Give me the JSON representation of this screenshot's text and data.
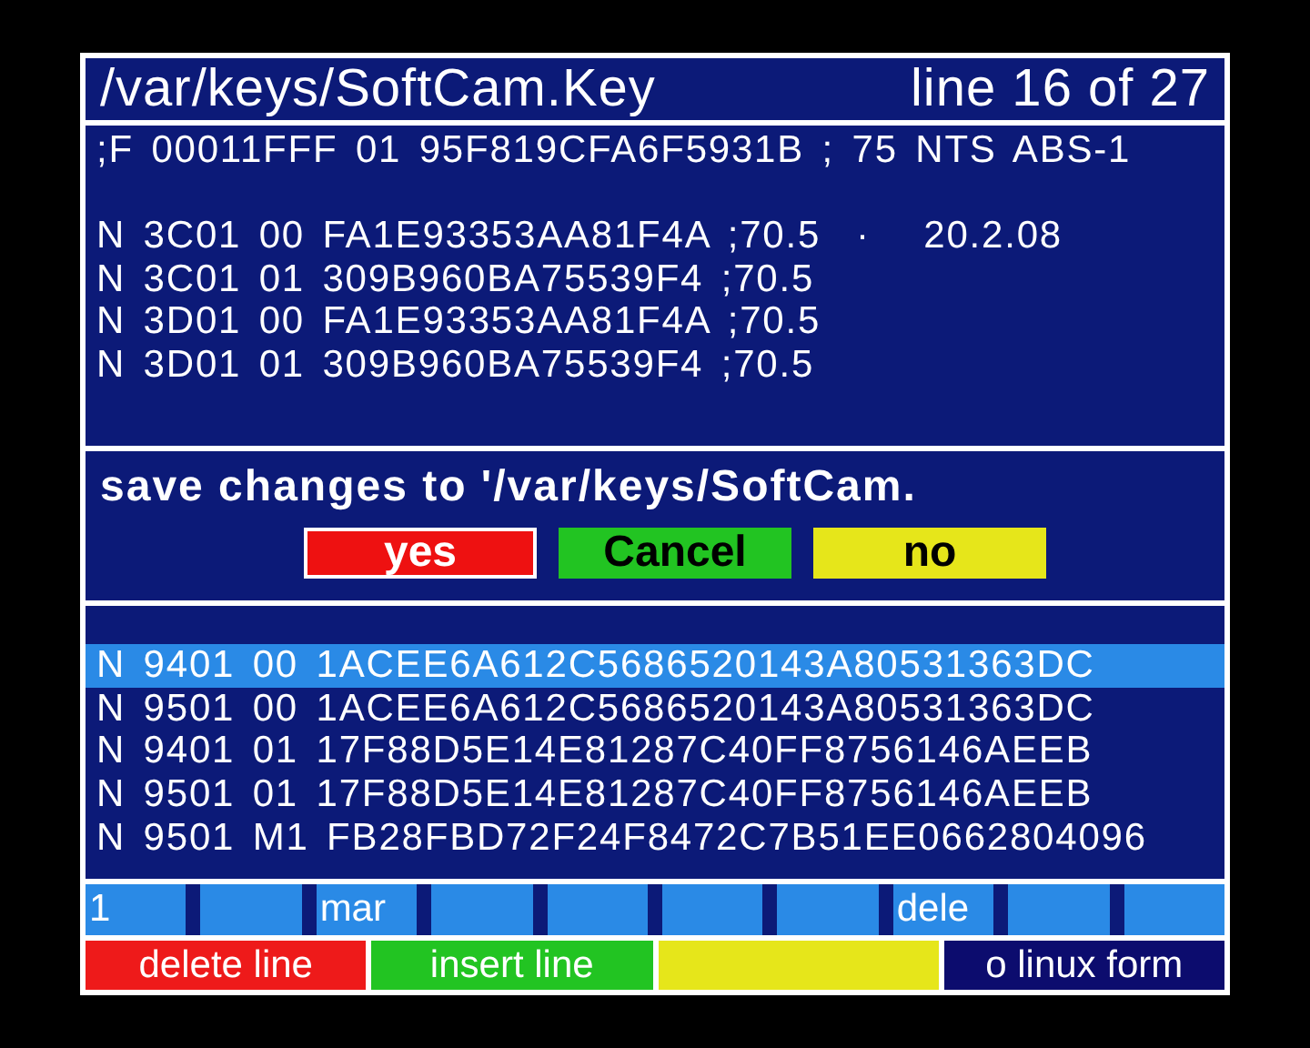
{
  "header": {
    "path": "/var/keys/SoftCam.Key",
    "position": "line 16 of 27"
  },
  "lines": [
    {
      "kind": "text",
      "text": ";F 00011FFF 01 95F819CFA6F5931B ; 75 NTS ABS-1",
      "selected": false
    },
    {
      "kind": "gap"
    },
    {
      "kind": "text",
      "text": "N 3C01 00 FA1E93353AA81F4A ;70.5  ·   20.2.08",
      "selected": false
    },
    {
      "kind": "text",
      "text": "N 3C01 01 309B960BA75539F4 ;70.5",
      "selected": false
    },
    {
      "kind": "text",
      "text": "N 3D01 00 FA1E93353AA81F4A ;70.5",
      "selected": false
    },
    {
      "kind": "text",
      "text": "N 3D01 01 309B960BA75539F4 ;70.5",
      "selected": false
    },
    {
      "kind": "gap"
    },
    {
      "kind": "gap"
    },
    {
      "kind": "gap"
    },
    {
      "kind": "gap"
    },
    {
      "kind": "gap"
    },
    {
      "kind": "gap"
    },
    {
      "kind": "text",
      "text": "N 9401 00 1ACEE6A612C5686520143A80531363DC",
      "selected": true
    },
    {
      "kind": "text",
      "text": "N 9501 00 1ACEE6A612C5686520143A80531363DC",
      "selected": false
    },
    {
      "kind": "text",
      "text": "N 9401 01 17F88D5E14E81287C40FF8756146AEEB",
      "selected": false
    },
    {
      "kind": "text",
      "text": "N 9501 01 17F88D5E14E81287C40FF8756146AEEB",
      "selected": false
    },
    {
      "kind": "text",
      "text": "N 9501 M1 FB28FBD72F24F8472C7B51EE0662804096",
      "selected": false
    }
  ],
  "dialog": {
    "message": "save changes to '/var/keys/SoftCam.",
    "buttons": [
      {
        "label": "yes",
        "color": "#ee1111",
        "selected": true
      },
      {
        "label": "Cancel",
        "color": "#22c422",
        "selected": false
      },
      {
        "label": "no",
        "color": "#e6e61a",
        "selected": false
      }
    ]
  },
  "function_bar": [
    {
      "kind": "label",
      "label": "1"
    },
    {
      "kind": "blank"
    },
    {
      "kind": "label",
      "label": "mar"
    },
    {
      "kind": "blank"
    },
    {
      "kind": "blank"
    },
    {
      "kind": "blank"
    },
    {
      "kind": "blank"
    },
    {
      "kind": "label",
      "label": "dele"
    },
    {
      "kind": "blank"
    },
    {
      "kind": "blank"
    }
  ],
  "color_keys": [
    {
      "label": "delete line",
      "color": "#ee1a1a"
    },
    {
      "label": "insert line",
      "color": "#22c422"
    },
    {
      "color": "#e6e61a"
    },
    {
      "label": "o linux form",
      "color": "#0c0c6e"
    }
  ]
}
